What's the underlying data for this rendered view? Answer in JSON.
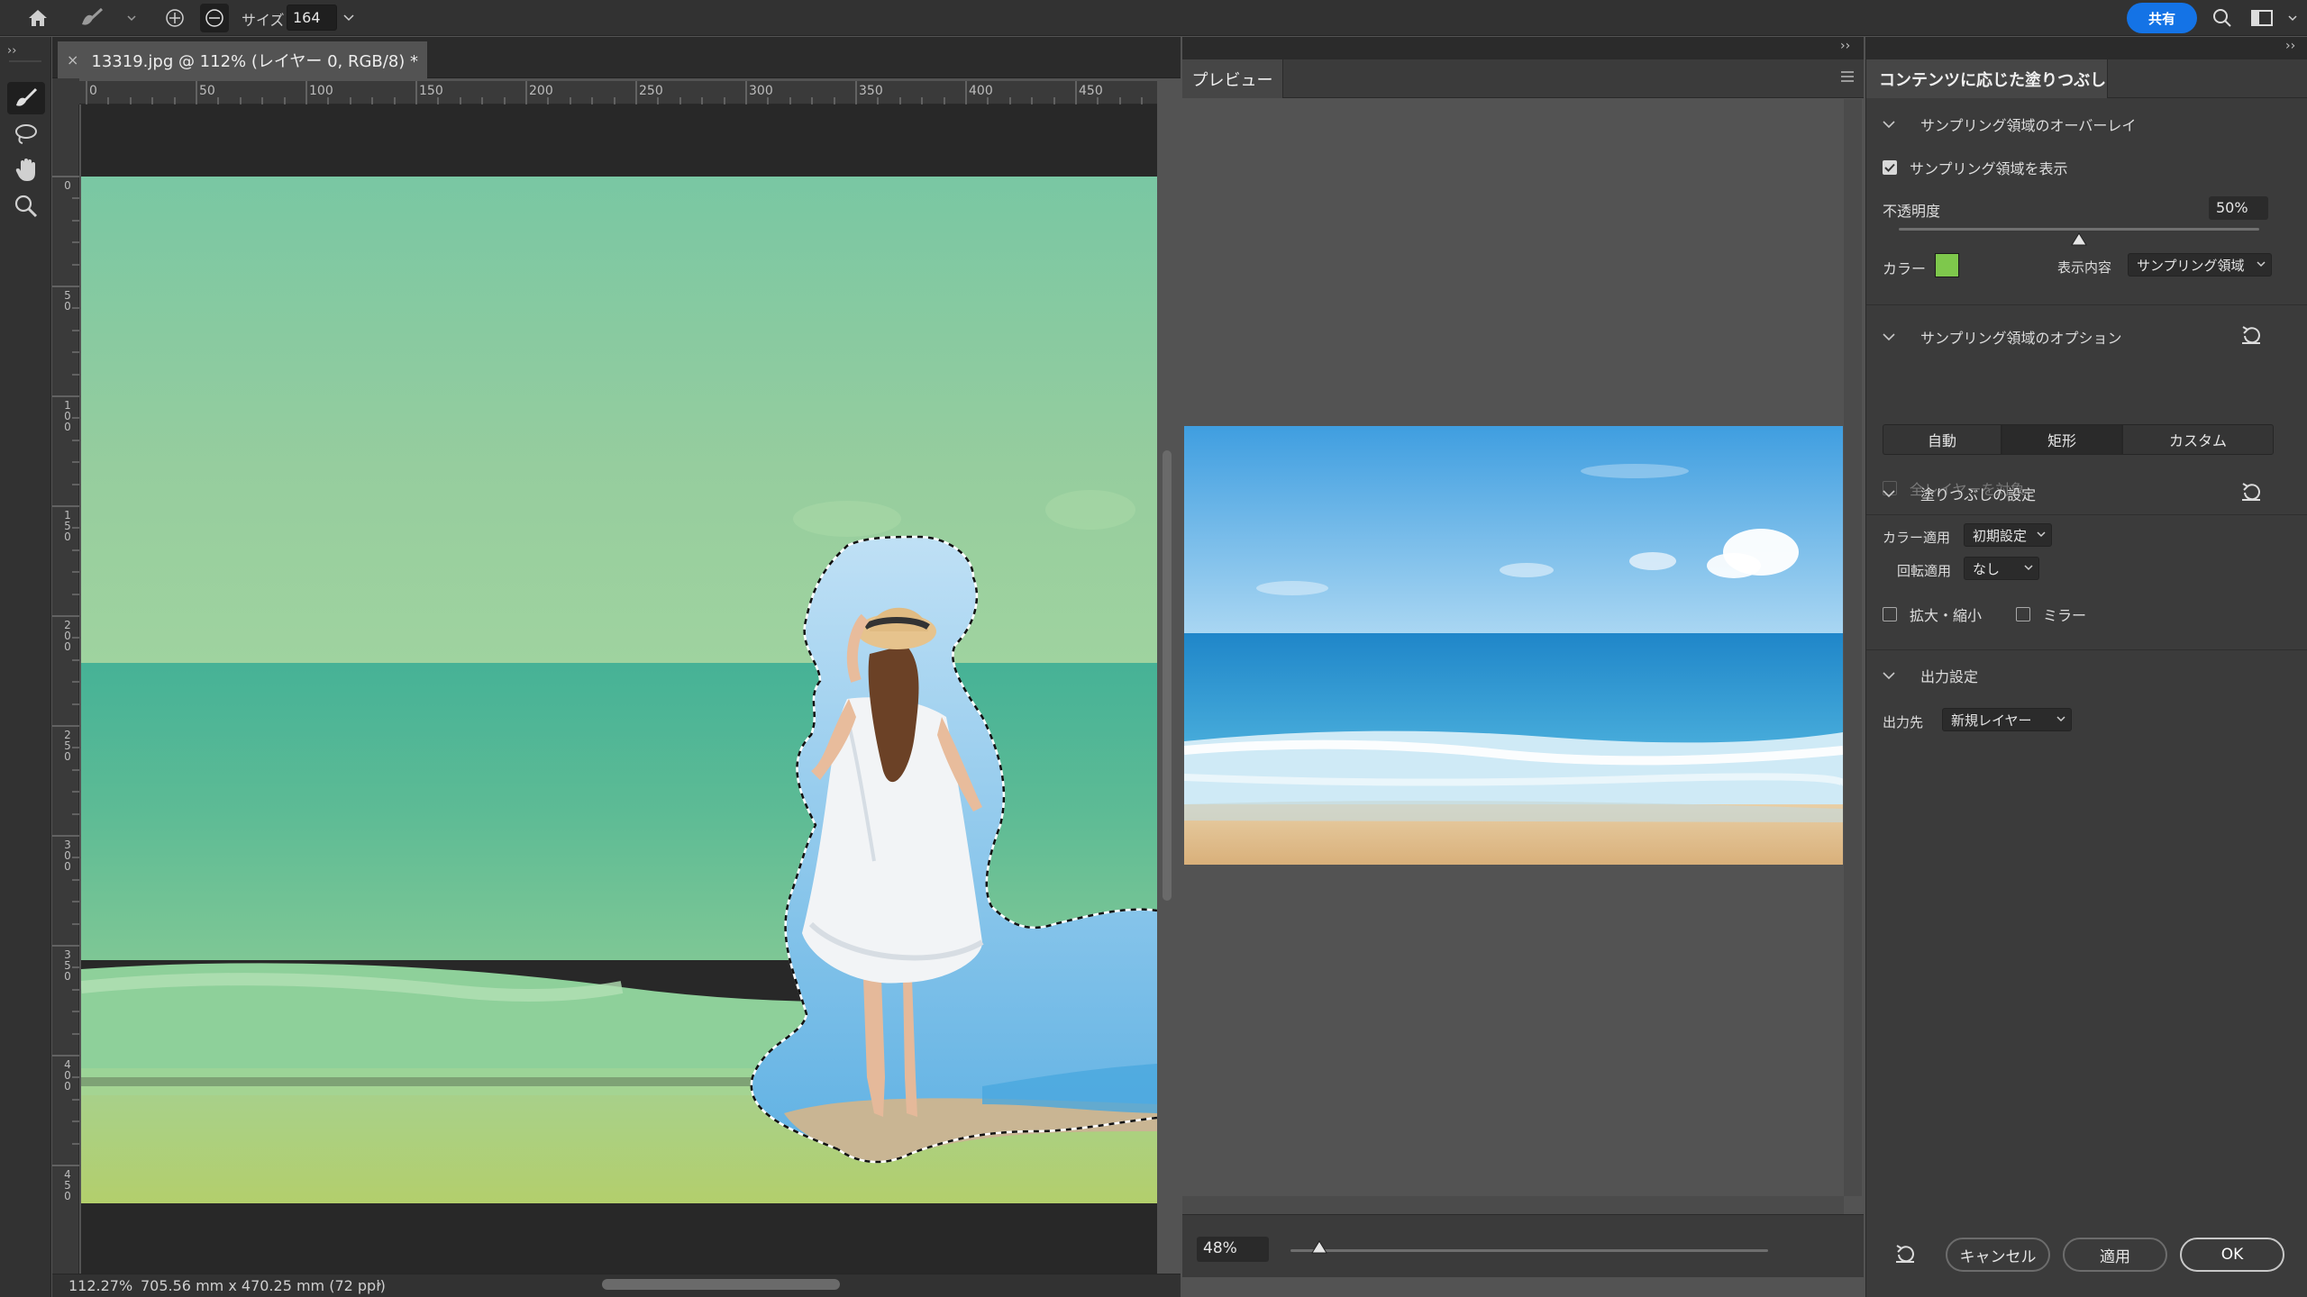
{
  "topbar": {
    "size_label": "サイズ",
    "size_value": "164",
    "share_label": "共有"
  },
  "document": {
    "tab_title": "13319.jpg @ 112% (レイヤー 0, RGB/8) *",
    "ruler_top": [
      "0",
      "50",
      "100",
      "150",
      "200",
      "250",
      "300",
      "350",
      "400",
      "450"
    ],
    "ruler_left": [
      "0",
      "50",
      "100",
      "150",
      "200",
      "250",
      "300",
      "350",
      "400",
      "450"
    ],
    "status_zoom": "112.27%",
    "status_info": "705.56 mm x 470.25 mm (72 ppi)"
  },
  "preview": {
    "tab_label": "プレビュー",
    "zoom_value": "48%",
    "zoom_fraction": 0.06
  },
  "panel": {
    "title": "コンテンツに応じた塗りつぶし",
    "overlay_section": "サンプリング領域のオーバーレイ",
    "show_sampling_label": "サンプリング領域を表示",
    "opacity_label": "不透明度",
    "opacity_value": "50%",
    "color_label": "カラー",
    "color_hex": "#7ec84c",
    "display_label": "表示内容",
    "display_value": "サンプリング領域",
    "options_section": "サンプリング領域のオプション",
    "seg_auto": "自動",
    "seg_rect": "矩形",
    "seg_custom": "カスタム",
    "all_layers_label": "全レイヤーを対象",
    "fill_section": "塗りつぶしの設定",
    "color_adapt_label": "カラー適用",
    "color_adapt_value": "初期設定",
    "rotation_label": "回転適用",
    "rotation_value": "なし",
    "scale_label": "拡大・縮小",
    "mirror_label": "ミラー",
    "output_section": "出力設定",
    "output_to_label": "出力先",
    "output_to_value": "新規レイヤー",
    "cancel_label": "キャンセル",
    "apply_label": "適用",
    "ok_label": "OK"
  }
}
